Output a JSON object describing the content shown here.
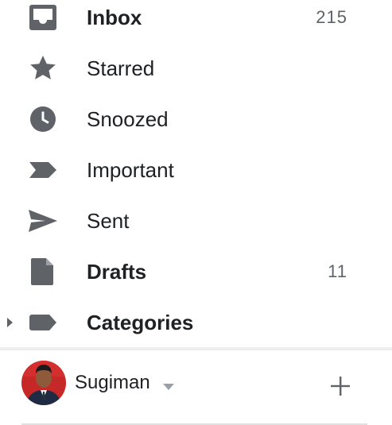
{
  "nav": {
    "inbox": {
      "label": "Inbox",
      "count": "215",
      "icon": "inbox-icon"
    },
    "starred": {
      "label": "Starred",
      "icon": "star-icon"
    },
    "snoozed": {
      "label": "Snoozed",
      "icon": "clock-icon"
    },
    "important": {
      "label": "Important",
      "icon": "important-icon"
    },
    "sent": {
      "label": "Sent",
      "icon": "send-icon"
    },
    "drafts": {
      "label": "Drafts",
      "count": "11",
      "icon": "draft-icon"
    },
    "categories": {
      "label": "Categories",
      "icon": "label-icon"
    }
  },
  "account": {
    "name": "Sugiman",
    "icons": [
      "avatar",
      "chevron-down-icon",
      "plus-icon"
    ]
  },
  "colors": {
    "icon_gray": "#5f6368",
    "text": "#202124",
    "count": "#5f6368",
    "divider": "#eeeeee"
  }
}
